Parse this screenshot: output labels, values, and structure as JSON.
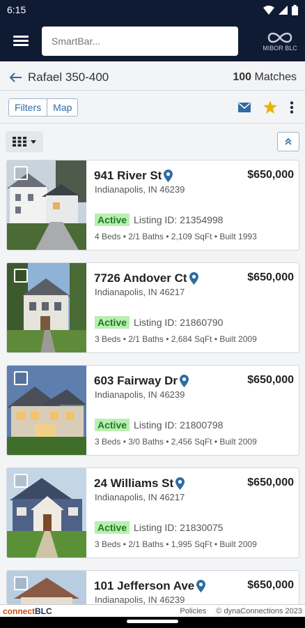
{
  "status_bar": {
    "time": "6:15"
  },
  "header": {
    "search_placeholder": "SmartBar...",
    "logo_text": "MIBOR BLC"
  },
  "nav": {
    "title": "Rafael 350-400",
    "matches_count": "100",
    "matches_label": "Matches"
  },
  "toolbar": {
    "filters_label": "Filters",
    "map_label": "Map"
  },
  "colors": {
    "header_bg": "#0f1b33",
    "accent": "#2f6ca3",
    "active_badge": "#b9efb0",
    "star": "#e8b400"
  },
  "listings": [
    {
      "address": "941 River St",
      "city": "Indianapolis, IN 46239",
      "price": "$650,000",
      "status": "Active",
      "listing_id": "Listing ID: 21354998",
      "details": "4 Beds • 2/1 Baths • 2,109 SqFt • Built 1993"
    },
    {
      "address": "7726 Andover Ct",
      "city": "Indianapolis, IN 46217",
      "price": "$650,000",
      "status": "Active",
      "listing_id": "Listing ID: 21860790",
      "details": "3 Beds • 2/1 Baths • 2,684 SqFt • Built 2009"
    },
    {
      "address": "603 Fairway Dr",
      "city": "Indianapolis, IN 46239",
      "price": "$650,000",
      "status": "Active",
      "listing_id": "Listing ID: 21800798",
      "details": "3 Beds • 3/0 Baths • 2,456 SqFt • Built 2009"
    },
    {
      "address": "24 Williams St",
      "city": "Indianapolis, IN 46217",
      "price": "$650,000",
      "status": "Active",
      "listing_id": "Listing ID: 21830075",
      "details": "3 Beds • 2/1 Baths • 1,995 SqFt • Built 2009"
    },
    {
      "address": "101 Jefferson Ave",
      "city": "Indianapolis, IN 46239",
      "price": "$650,000"
    }
  ],
  "footer": {
    "brand_part1": "connect",
    "brand_part2": "BLC",
    "policies": "Policies",
    "copyright": "© dynaConnections 2023"
  }
}
